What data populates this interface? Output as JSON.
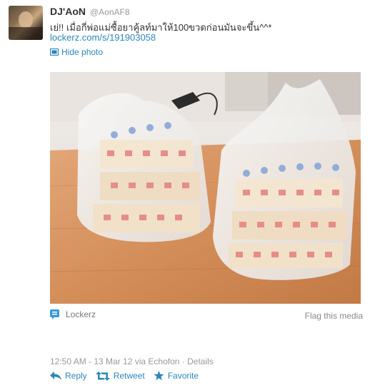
{
  "tweet": {
    "user": {
      "name": "DJ'AoN",
      "handle": "@AonAF8"
    },
    "text": "เย่!! เมื่อกี่พ่อแม่ซื้อยาคู้ลท์มาให้100ขวดก่อนมันจะขึ้น^^*",
    "link": "lockerz.com/s/191903058",
    "hide_photo_label": "Hide photo",
    "media": {
      "source_label": "Lockerz",
      "flag_label": "Flag this media"
    },
    "meta": "12:50 AM - 13 Mar 12 via Echofon · Details",
    "actions": {
      "reply": "Reply",
      "retweet": "Retweet",
      "favorite": "Favorite"
    }
  },
  "colors": {
    "link": "#2a87b8",
    "muted": "#999999",
    "text": "#333333"
  },
  "icons": {
    "hide_photo": "photo-icon",
    "media_source": "lockerz-icon",
    "reply": "reply-arrow-icon",
    "retweet": "retweet-icon",
    "favorite": "star-icon"
  }
}
